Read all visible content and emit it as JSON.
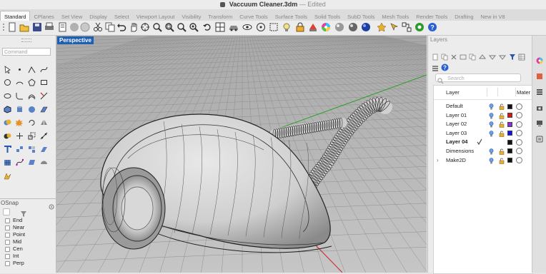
{
  "window": {
    "title": "Vaccuum Cleaner.3dm",
    "separator": "—",
    "status": "Edited"
  },
  "tabs": [
    "Standard",
    "CPlanes",
    "Set View",
    "Display",
    "Select",
    "Viewport Layout",
    "Visibility",
    "Transform",
    "Curve Tools",
    "Surface Tools",
    "Solid Tools",
    "SubD Tools",
    "Mesh Tools",
    "Render Tools",
    "Drafting",
    "New in V8"
  ],
  "active_tab": "Standard",
  "command": {
    "placeholder": "Command"
  },
  "osnap": {
    "title": "OSnap",
    "items": [
      {
        "label": "End",
        "checked": false
      },
      {
        "label": "Near",
        "checked": false
      },
      {
        "label": "Point",
        "checked": false
      },
      {
        "label": "Mid",
        "checked": false
      },
      {
        "label": "Cen",
        "checked": false
      },
      {
        "label": "Int",
        "checked": false
      },
      {
        "label": "Perp",
        "checked": false
      }
    ]
  },
  "viewport": {
    "label": "Perspective"
  },
  "layers_panel": {
    "title": "Layers",
    "search_placeholder": "Search",
    "header": {
      "layer": "Layer",
      "material": "Mater"
    },
    "rows": [
      {
        "name": "Default",
        "color": "#111111",
        "current": false,
        "bold": false,
        "expandable": false
      },
      {
        "name": "Layer 01",
        "color": "#e01010",
        "current": false,
        "bold": false,
        "expandable": false
      },
      {
        "name": "Layer 02",
        "color": "#8a2be2",
        "current": false,
        "bold": false,
        "expandable": false
      },
      {
        "name": "Layer 03",
        "color": "#1010ee",
        "current": false,
        "bold": false,
        "expandable": false
      },
      {
        "name": "Layer 04",
        "color": "#111111",
        "current": true,
        "bold": true,
        "expandable": false
      },
      {
        "name": "Dimensions",
        "color": "#111111",
        "current": false,
        "bold": false,
        "expandable": false
      },
      {
        "name": "Make2D",
        "color": "#111111",
        "current": false,
        "bold": false,
        "expandable": true
      }
    ]
  },
  "colors": {
    "accent": "#1e5fb3",
    "axis_x": "#cc2222",
    "axis_y": "#22aa22"
  }
}
